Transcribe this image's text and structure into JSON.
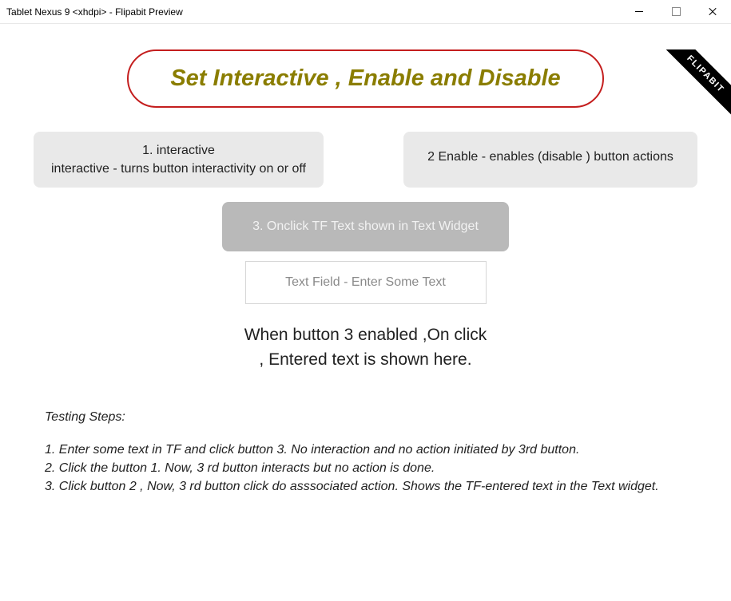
{
  "window": {
    "title": "Tablet Nexus 9 <xhdpi>  - Flipabit Preview"
  },
  "ribbon": {
    "label": "FLIPABIT"
  },
  "heading": "Set Interactive , Enable and Disable",
  "buttons": {
    "btn1_line1": "1. interactive",
    "btn1_line2": "interactive - turns button interactivity on or off",
    "btn2": "2  Enable -  enables (disable ) button actions",
    "btn3": "3.  Onclick TF Text shown in Text Widget"
  },
  "textfield": {
    "placeholder": "Text Field - Enter Some Text"
  },
  "resultText": "When  button 3 enabled ,On click , Entered text is shown here.",
  "steps": {
    "title": "Testing Steps:",
    "s1": "1. Enter some text in TF and click button 3. No interaction and no action initiated by 3rd button.",
    "s2": "2. Click the button 1. Now, 3 rd button interacts but no action is done.",
    "s3": "3. Click button 2 , Now, 3 rd button click do asssociated action. Shows the TF-entered text in the Text widget."
  }
}
